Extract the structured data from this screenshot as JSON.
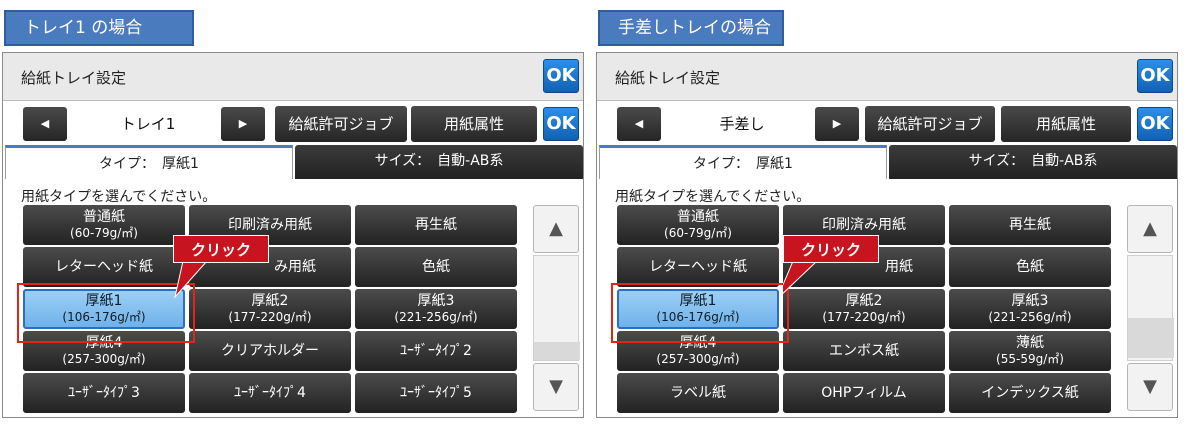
{
  "panels": [
    {
      "tag": "トレイ1 の場合",
      "title": "給紙トレイ設定",
      "ok_label": "OK",
      "prev_icon": "◀",
      "next_icon": "▶",
      "tray": "トレイ1",
      "job_button": "給紙許可ジョブ",
      "attr_button": "用紙属性",
      "tab_type": "タイプ：　厚紙1",
      "tab_size": "サイズ：　自動-AB系",
      "instruction": "用紙タイプを選んでください。",
      "buttons": [
        {
          "name": "普通紙",
          "sub": "(60-79g/㎡)"
        },
        {
          "name": "印刷済み用紙",
          "sub": ""
        },
        {
          "name": "再生紙",
          "sub": ""
        },
        {
          "name": "レターヘッド紙",
          "sub": ""
        },
        {
          "name": "み用紙",
          "sub": ""
        },
        {
          "name": "色紙",
          "sub": ""
        },
        {
          "name": "厚紙1",
          "sub": "(106-176g/㎡)"
        },
        {
          "name": "厚紙2",
          "sub": "(177-220g/㎡)"
        },
        {
          "name": "厚紙3",
          "sub": "(221-256g/㎡)"
        },
        {
          "name": "厚紙4",
          "sub": "(257-300g/㎡)"
        },
        {
          "name": "クリアホルダー",
          "sub": ""
        },
        {
          "name": "ﾕｰｻﾞｰﾀｲﾌﾟ2",
          "sub": ""
        },
        {
          "name": "ﾕｰｻﾞｰﾀｲﾌﾟ3",
          "sub": ""
        },
        {
          "name": "ﾕｰｻﾞｰﾀｲﾌﾟ4",
          "sub": ""
        },
        {
          "name": "ﾕｰｻﾞｰﾀｲﾌﾟ5",
          "sub": ""
        }
      ],
      "scroll_up": "▲",
      "scroll_down": "▼",
      "click_label": "クリック"
    },
    {
      "tag": "手差しトレイの場合",
      "title": "給紙トレイ設定",
      "ok_label": "OK",
      "prev_icon": "◀",
      "next_icon": "▶",
      "tray": "手差し",
      "job_button": "給紙許可ジョブ",
      "attr_button": "用紙属性",
      "tab_type": "タイプ：　厚紙1",
      "tab_size": "サイズ：　自動-AB系",
      "instruction": "用紙タイプを選んでください。",
      "buttons": [
        {
          "name": "普通紙",
          "sub": "(60-79g/㎡)"
        },
        {
          "name": "印刷済み用紙",
          "sub": ""
        },
        {
          "name": "再生紙",
          "sub": ""
        },
        {
          "name": "レターヘッド紙",
          "sub": ""
        },
        {
          "name": "用紙",
          "sub": ""
        },
        {
          "name": "色紙",
          "sub": ""
        },
        {
          "name": "厚紙1",
          "sub": "(106-176g/㎡)"
        },
        {
          "name": "厚紙2",
          "sub": "(177-220g/㎡)"
        },
        {
          "name": "厚紙3",
          "sub": "(221-256g/㎡)"
        },
        {
          "name": "厚紙4",
          "sub": "(257-300g/㎡)"
        },
        {
          "name": "エンボス紙",
          "sub": ""
        },
        {
          "name": "薄紙",
          "sub": "(55-59g/㎡)"
        },
        {
          "name": "ラベル紙",
          "sub": ""
        },
        {
          "name": "OHPフィルム",
          "sub": ""
        },
        {
          "name": "インデックス紙",
          "sub": ""
        }
      ],
      "scroll_up": "▲",
      "scroll_down": "▼",
      "click_label": "クリック"
    }
  ],
  "colors": {
    "selected": "#8cc4f2",
    "highlight": "#e0261b",
    "ok_blue": "#1976d2",
    "tag_blue": "#4a7bbf"
  }
}
